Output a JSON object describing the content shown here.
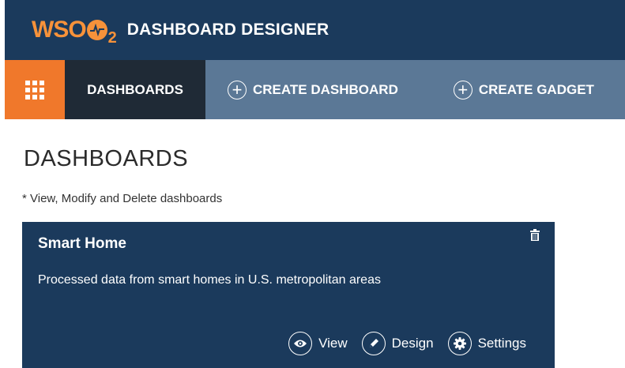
{
  "header": {
    "logo_text": "WSO",
    "logo_sub": "2",
    "app_title": "DASHBOARD DESIGNER"
  },
  "nav": {
    "menu_icon": "apps-grid-icon",
    "tabs": [
      {
        "label": "DASHBOARDS",
        "active": true
      },
      {
        "label": "CREATE DASHBOARD",
        "icon": "plus-circle-icon"
      },
      {
        "label": "CREATE GADGET",
        "icon": "plus-circle-icon"
      }
    ]
  },
  "main": {
    "heading": "DASHBOARDS",
    "subtitle": "* View, Modify and Delete dashboards"
  },
  "cards": [
    {
      "title": "Smart Home",
      "description": "Processed data from smart homes in U.S. metropolitan areas",
      "delete_icon": "trash-icon",
      "actions": [
        {
          "label": "View",
          "icon": "eye-icon"
        },
        {
          "label": "Design",
          "icon": "pencil-icon"
        },
        {
          "label": "Settings",
          "icon": "gear-icon"
        }
      ]
    }
  ],
  "colors": {
    "header_bg": "#1b3a5c",
    "nav_bg": "#5b7896",
    "accent": "#f0782b",
    "active_tab_bg": "#1f2a36",
    "card_bg": "#1b3a5c"
  }
}
